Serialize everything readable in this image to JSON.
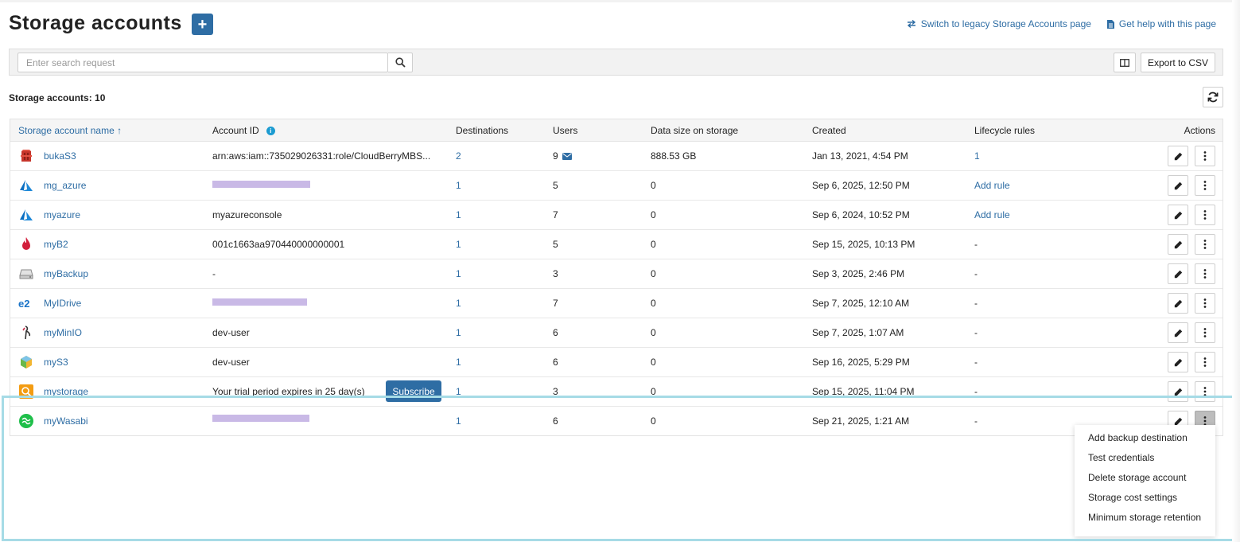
{
  "header": {
    "title": "Storage accounts",
    "add_label": "+",
    "legacy_link": "Switch to legacy Storage Accounts page",
    "help_link": "Get help with this page"
  },
  "toolbar": {
    "search_placeholder": "Enter search request",
    "export_label": "Export to CSV"
  },
  "summary": {
    "count_label": "Storage accounts: 10"
  },
  "table": {
    "columns": {
      "name": "Storage account name",
      "account_id": "Account ID",
      "destinations": "Destinations",
      "users": "Users",
      "data_size": "Data size on storage",
      "created": "Created",
      "lifecycle": "Lifecycle rules",
      "actions": "Actions"
    },
    "sort_glyph": "↑",
    "rows": [
      {
        "icon": "aws-s3-icon",
        "name": "bukaS3",
        "account_id": "arn:aws:iam::735029026331:role/CloudBerryMBS...",
        "destinations": "2",
        "users": "9",
        "data_size": "888.53 GB",
        "created": "Jan 13, 2021, 4:54 PM",
        "lifecycle": "1"
      },
      {
        "icon": "azure-icon",
        "name": "mg_azure",
        "account_id": "",
        "destinations": "1",
        "users": "5",
        "data_size": "0",
        "created": "Sep 6, 2025, 12:50 PM",
        "lifecycle": "Add rule"
      },
      {
        "icon": "azure-icon",
        "name": "myazure",
        "account_id": "myazureconsole",
        "destinations": "1",
        "users": "7",
        "data_size": "0",
        "created": "Sep 6, 2024, 10:52 PM",
        "lifecycle": "Add rule"
      },
      {
        "icon": "backblaze-icon",
        "name": "myB2",
        "account_id": "001c1663aa970440000000001",
        "destinations": "1",
        "users": "5",
        "data_size": "0",
        "created": "Sep 15, 2025, 10:13 PM",
        "lifecycle": "-"
      },
      {
        "icon": "local-drive-icon",
        "name": "myBackup",
        "account_id": "-",
        "destinations": "1",
        "users": "3",
        "data_size": "0",
        "created": "Sep 3, 2025, 2:46 PM",
        "lifecycle": "-"
      },
      {
        "icon": "idrive-e2-icon",
        "name": "MyIDrive",
        "account_id": "",
        "destinations": "1",
        "users": "7",
        "data_size": "0",
        "created": "Sep 7, 2025, 12:10 AM",
        "lifecycle": "-"
      },
      {
        "icon": "minio-icon",
        "name": "myMinIO",
        "account_id": "dev-user",
        "destinations": "1",
        "users": "6",
        "data_size": "0",
        "created": "Sep 7, 2025, 1:07 AM",
        "lifecycle": "-"
      },
      {
        "icon": "s3-compatible-icon",
        "name": "myS3",
        "account_id": "dev-user",
        "destinations": "1",
        "users": "6",
        "data_size": "0",
        "created": "Sep 16, 2025, 5:29 PM",
        "lifecycle": "-"
      },
      {
        "icon": "msp360-storage-icon",
        "name": "mystorage",
        "account_id": "Your trial period expires in 25 day(s)",
        "subscribe": "Subscribe",
        "destinations": "1",
        "users": "3",
        "data_size": "0",
        "created": "Sep 15, 2025, 11:04 PM",
        "lifecycle": "-"
      },
      {
        "icon": "wasabi-icon",
        "name": "myWasabi",
        "account_id": "",
        "destinations": "1",
        "users": "6",
        "data_size": "0",
        "created": "Sep 21, 2025, 1:21 AM",
        "lifecycle": "-"
      }
    ]
  },
  "context_menu": {
    "items": [
      "Add backup destination",
      "Test credentials",
      "Delete storage account",
      "Storage cost settings",
      "Minimum storage retention"
    ]
  },
  "colors": {
    "accent": "#2e6da4",
    "highlight": "#a6dbe6",
    "redaction": "#c9b9e6"
  }
}
